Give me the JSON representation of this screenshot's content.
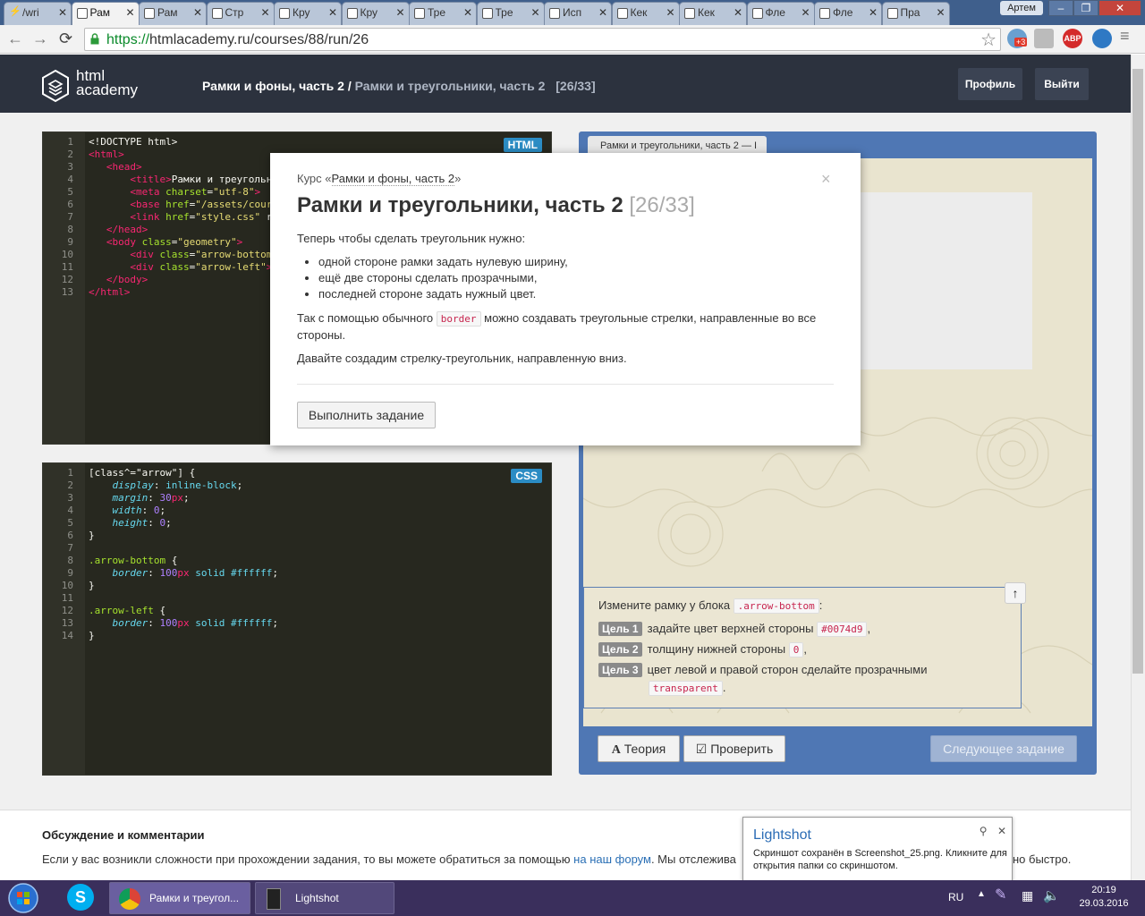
{
  "browser": {
    "tabs": [
      {
        "label": "/wri",
        "icon": "lightning-icon"
      },
      {
        "label": "Рам",
        "icon": "htmlacademy-icon"
      },
      {
        "label": "Рам",
        "icon": "htmlacademy-icon"
      },
      {
        "label": "Стр",
        "icon": "htmlacademy-icon"
      },
      {
        "label": "Кру",
        "icon": "htmlacademy-icon"
      },
      {
        "label": "Кру",
        "icon": "htmlacademy-icon"
      },
      {
        "label": "Тре",
        "icon": "htmlacademy-icon"
      },
      {
        "label": "Тре",
        "icon": "htmlacademy-icon"
      },
      {
        "label": "Исп",
        "icon": "htmlacademy-icon"
      },
      {
        "label": "Кек",
        "icon": "htmlacademy-icon"
      },
      {
        "label": "Кек",
        "icon": "htmlacademy-icon"
      },
      {
        "label": "Фле",
        "icon": "htmlacademy-icon"
      },
      {
        "label": "Фле",
        "icon": "htmlacademy-icon"
      },
      {
        "label": "Пра",
        "icon": "htmlacademy-icon"
      }
    ],
    "active_tab_index": 1,
    "user_label": "Артем",
    "url_scheme": "https://",
    "url_rest": "htmlacademy.ru/courses/88/run/26",
    "ext_badge": "+3",
    "abp_label": "ABP"
  },
  "site": {
    "logo_line1": "html",
    "logo_line2": "academy",
    "crumb_course": "Рамки и фоны, часть 2",
    "crumb_sep": " / ",
    "crumb_lesson": "Рамки и треугольники, часть 2",
    "crumb_progress": "[26/33]",
    "profile_label": "Профиль",
    "logout_label": "Выйти"
  },
  "html_editor": {
    "lang": "HTML",
    "lines": [
      "1",
      "2",
      "3",
      "4",
      "5",
      "6",
      "7",
      "8",
      "9",
      "10",
      "11",
      "12",
      "13"
    ]
  },
  "css_editor": {
    "lang": "CSS",
    "lines": [
      "1",
      "2",
      "3",
      "4",
      "5",
      "6",
      "7",
      "8",
      "9",
      "10",
      "11",
      "12",
      "13",
      "14"
    ]
  },
  "preview": {
    "tab_label": "Рамки и треугольники, часть 2 — I",
    "goals_intro": "Измените рамку у блока",
    "goals_intro_code": ".arrow-bottom",
    "goals_intro_end": ":",
    "goals": [
      {
        "badge": "Цель 1",
        "text": "задайте цвет верхней стороны",
        "code": "#0074d9",
        "end": ","
      },
      {
        "badge": "Цель 2",
        "text": "толщину нижней стороны",
        "code": "0",
        "end": ","
      },
      {
        "badge": "Цель 3",
        "text": "цвет левой и правой сторон сделайте прозрачными",
        "code": "transparent",
        "end": "."
      }
    ],
    "theory_label": "Теория",
    "check_label": "Проверить",
    "next_label": "Следующее задание"
  },
  "modal": {
    "course_prefix": "Курс «",
    "course_name": "Рамки и фоны, часть 2",
    "course_suffix": "»",
    "title": "Рамки и треугольники, часть 2",
    "progress": "[26/33]",
    "p1": "Теперь чтобы сделать треугольник нужно:",
    "bullets": [
      "одной стороне рамки задать нулевую ширину,",
      "ещё две стороны сделать прозрачными,",
      "последней стороне задать нужный цвет."
    ],
    "p2_before": "Так с помощью обычного",
    "p2_code": "border",
    "p2_after": "можно создавать треугольные стрелки, направленные во все стороны.",
    "p3": "Давайте создадим стрелку-треугольник, направленную вниз.",
    "button_label": "Выполнить задание",
    "close_glyph": "×"
  },
  "discussion": {
    "title": "Обсуждение и комментарии",
    "text_before": "Если у вас возникли сложности при прохождении задания, то вы можете обратиться за помощью",
    "link": "на наш форум",
    "text_after": ". Мы отслежива",
    "tail": "но быстро."
  },
  "lightshot": {
    "title": "Lightshot",
    "message": "Скриншот сохранён в Screenshot_25.png. Кликните для открытия папки со скриншотом."
  },
  "taskbar": {
    "chrome_label": "Рамки и треугол...",
    "lightshot_label": "Lightshot",
    "lang": "RU",
    "time": "20:19",
    "date": "29.03.2016"
  }
}
